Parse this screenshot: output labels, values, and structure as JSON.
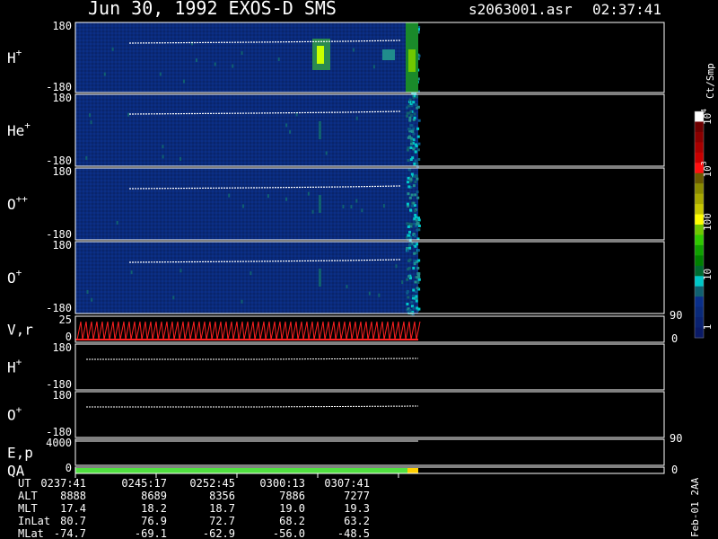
{
  "header": {
    "title": "Jun 30, 1992   EXOS-D SMS",
    "file": "s2063001.asr",
    "time": "02:37:41"
  },
  "colorbar": {
    "title": "Ct/Smp",
    "labels": [
      {
        "base": "10",
        "exp": "4",
        "v": 10000
      },
      {
        "base": "10",
        "exp": "3",
        "v": 1000
      },
      {
        "base": "100",
        "exp": "",
        "v": 100
      },
      {
        "base": "10",
        "exp": "",
        "v": 10
      },
      {
        "base": "1",
        "exp": "",
        "v": 1
      }
    ],
    "colors": [
      "#ffffff",
      "#6e0000",
      "#8a0000",
      "#a80000",
      "#c80000",
      "#ff1010",
      "#6a5a00",
      "#8a8a00",
      "#a8a800",
      "#c8c800",
      "#ffff00",
      "#70c800",
      "#30c800",
      "#10a000",
      "#008000",
      "#006a30",
      "#00c8c8",
      "#106070",
      "#0a2f8a",
      "#0a2a7a",
      "#0a2270",
      "#0a1a66"
    ]
  },
  "footer": {
    "rows": [
      {
        "label": "UT",
        "values": [
          "0237:41",
          "0245:17",
          "0252:45",
          "0300:13",
          "0307:41"
        ]
      },
      {
        "label": "ALT",
        "values": [
          "8888",
          "8689",
          "8356",
          "7886",
          "7277"
        ]
      },
      {
        "label": "MLT",
        "values": [
          "17.4",
          "18.2",
          "18.7",
          "19.0",
          "19.3"
        ]
      },
      {
        "label": "InLat",
        "values": [
          "80.7",
          "76.9",
          "72.7",
          "68.2",
          "63.2"
        ]
      },
      {
        "label": "MLat",
        "values": [
          "-74.7",
          "-69.1",
          "-62.9",
          "-56.0",
          "-48.5"
        ]
      }
    ],
    "stamp": "Feb-01 2AA"
  },
  "chart_data": {
    "type": "heatmap",
    "panels": [
      {
        "label": "H",
        "sup": "+",
        "ymax": "180",
        "ymin": "-180"
      },
      {
        "label": "He",
        "sup": "+",
        "ymax": "180",
        "ymin": "-180"
      },
      {
        "label": "O",
        "sup": "++",
        "ymax": "180",
        "ymin": "-180"
      },
      {
        "label": "O",
        "sup": "+",
        "ymax": "180",
        "ymin": "-180"
      },
      {
        "label": "V,r",
        "sup": "",
        "ymax": "25",
        "ymin": "0",
        "right_top": "90",
        "right_bottom": "0"
      },
      {
        "label": "H",
        "sup": "+",
        "ymax": "180",
        "ymin": "-180"
      },
      {
        "label": "O",
        "sup": "+",
        "ymax": "180",
        "ymin": "-180"
      },
      {
        "label": "E,p",
        "sup": "",
        "ymax": "4000",
        "ymin": "",
        "right_top": "90"
      },
      {
        "label": "QA",
        "sup": "",
        "ymax": "",
        "ymin": "0",
        "right_bottom": "0"
      }
    ],
    "x_ticks_ut": [
      "0237:41",
      "0245:17",
      "0252:45",
      "0300:13",
      "0307:41"
    ]
  }
}
